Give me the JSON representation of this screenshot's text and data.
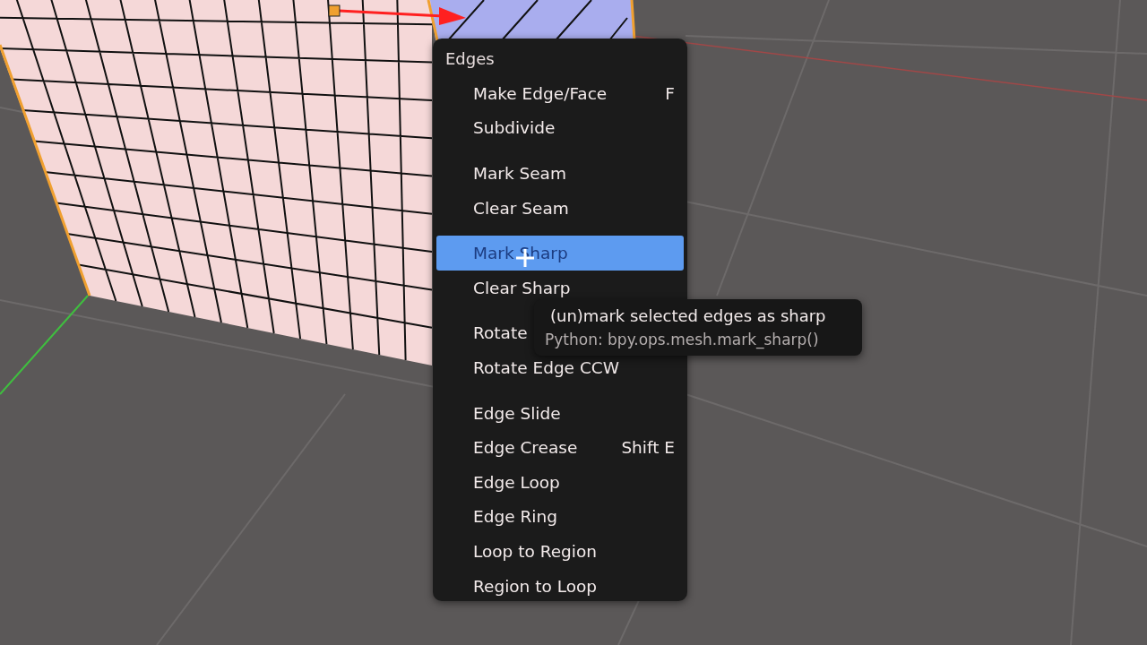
{
  "menu": {
    "title": "Edges",
    "groups": [
      {
        "items": [
          {
            "label": "Make Edge/Face",
            "shortcut": "F",
            "selected": false
          },
          {
            "label": "Subdivide",
            "selected": false
          }
        ]
      },
      {
        "items": [
          {
            "label": "Mark Seam",
            "selected": false
          },
          {
            "label": "Clear Seam",
            "selected": false
          }
        ]
      },
      {
        "items": [
          {
            "label": "Mark Sharp",
            "selected": true
          },
          {
            "label": "Clear Sharp",
            "selected": false
          }
        ]
      },
      {
        "items": [
          {
            "label": "Rotate",
            "selected": false
          },
          {
            "label": "Rotate Edge CCW",
            "selected": false
          }
        ]
      },
      {
        "items": [
          {
            "label": "Edge Slide",
            "selected": false
          },
          {
            "label": "Edge Crease",
            "shortcut": "Shift E",
            "selected": false
          },
          {
            "label": "Edge Loop",
            "selected": false
          },
          {
            "label": "Edge Ring",
            "selected": false
          },
          {
            "label": "Loop to Region",
            "selected": false
          },
          {
            "label": "Region to Loop",
            "selected": false
          }
        ]
      }
    ]
  },
  "tooltip": {
    "description": "(un)mark selected edges as sharp",
    "python": "Python: bpy.ops.mesh.mark_sharp()"
  }
}
